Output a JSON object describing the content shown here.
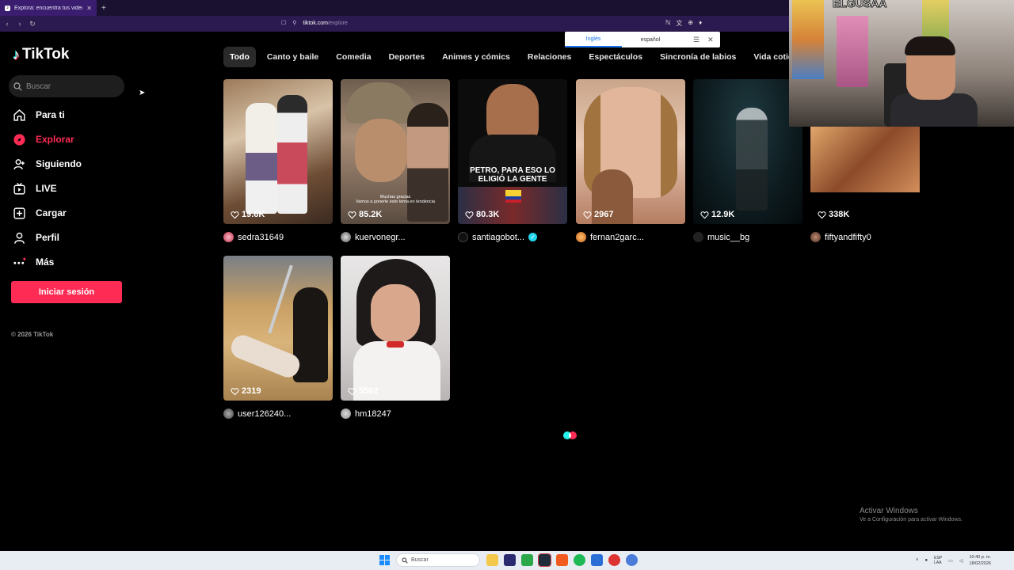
{
  "browser": {
    "tab_title": "Explora: encuentra tus videos fa",
    "url_host": "tiktok.com",
    "url_path": "/explore",
    "translate": {
      "source_lang": "Inglés",
      "target_lang": "español"
    }
  },
  "sidebar": {
    "logo": "TikTok",
    "search_placeholder": "Buscar",
    "items": [
      {
        "label": "Para ti",
        "icon": "home-icon",
        "active": false
      },
      {
        "label": "Explorar",
        "icon": "compass-icon",
        "active": true
      },
      {
        "label": "Siguiendo",
        "icon": "following-icon",
        "active": false
      },
      {
        "label": "LIVE",
        "icon": "live-icon",
        "active": false
      },
      {
        "label": "Cargar",
        "icon": "upload-icon",
        "active": false
      },
      {
        "label": "Perfil",
        "icon": "profile-icon",
        "active": false
      },
      {
        "label": "Más",
        "icon": "more-icon",
        "active": false
      }
    ],
    "login_button": "Iniciar sesión",
    "copyright": "© 2026 TikTok"
  },
  "categories": [
    "Todo",
    "Canto y baile",
    "Comedia",
    "Deportes",
    "Animes y cómics",
    "Relaciones",
    "Espectáculos",
    "Sincronía de labios",
    "Vida cotidiana"
  ],
  "videos": [
    {
      "likes": "19.6K",
      "author": "sedra31649",
      "verified": false,
      "overlay": ""
    },
    {
      "likes": "85.2K",
      "author": "kuervonegr...",
      "verified": false,
      "overlay": "Muchas gracias\nVamos a ponerle este tema en tendencia"
    },
    {
      "likes": "80.3K",
      "author": "santiagobot...",
      "verified": true,
      "overlay": "PETRO, PARA ESO LO ELIGIÓ LA GENTE"
    },
    {
      "likes": "2967",
      "author": "fernan2garc...",
      "verified": false,
      "overlay": ""
    },
    {
      "likes": "12.9K",
      "author": "music__bg",
      "verified": false,
      "overlay": ""
    },
    {
      "likes": "338K",
      "author": "fiftyandfifty0",
      "verified": false,
      "overlay": ""
    },
    {
      "likes": "2319",
      "author": "user126240...",
      "verified": false,
      "overlay": ""
    },
    {
      "likes": "5562",
      "author": "hm18247",
      "verified": false,
      "overlay": ""
    }
  ],
  "webcam_caption": "ELGUSAA",
  "windows": {
    "activate_title": "Activar Windows",
    "activate_sub": "Ve a Configuración para activar Windows.",
    "taskbar_search": "Buscar",
    "lang": "ESP\nLAA",
    "time": "10:40 p. m.",
    "date": "18/02/2026"
  },
  "colors": {
    "accent": "#fe2c55",
    "cyan": "#25f4ee",
    "bg": "#000000"
  }
}
